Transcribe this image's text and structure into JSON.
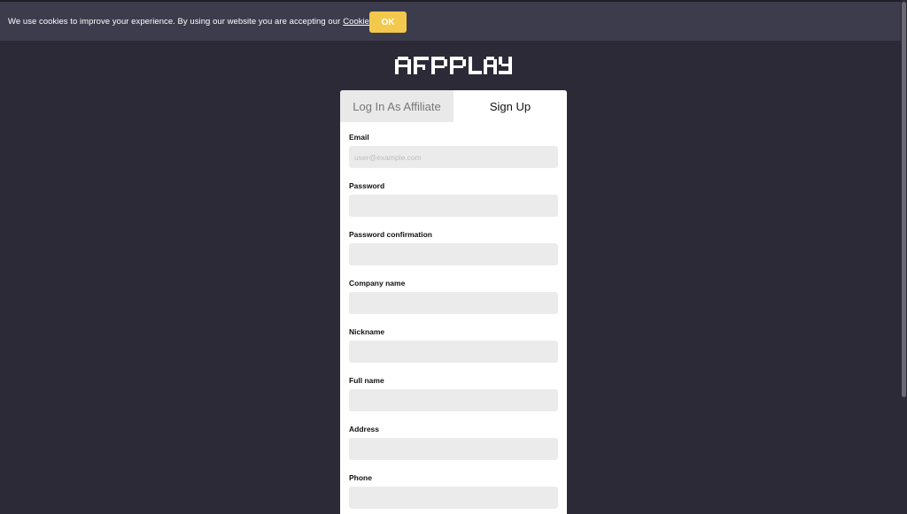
{
  "cookie_bar": {
    "text": "We use cookies to improve your experience. By using our website you are accepting our",
    "link_label": "Cookie Policy",
    "ok_label": "OK"
  },
  "logo": {
    "text": "AFFPLAY",
    "icon": "affplay-logo"
  },
  "tabs": [
    {
      "label": "Log In As Affiliate",
      "active": false
    },
    {
      "label": "Sign Up",
      "active": true
    }
  ],
  "form": {
    "fields": [
      {
        "label": "Email",
        "placeholder": "user@example.com",
        "value": ""
      },
      {
        "label": "Password",
        "placeholder": "",
        "value": ""
      },
      {
        "label": "Password confirmation",
        "placeholder": "",
        "value": ""
      },
      {
        "label": "Company name",
        "placeholder": "",
        "value": ""
      },
      {
        "label": "Nickname",
        "placeholder": "",
        "value": ""
      },
      {
        "label": "Full name",
        "placeholder": "",
        "value": ""
      },
      {
        "label": "Address",
        "placeholder": "",
        "value": ""
      },
      {
        "label": "Phone",
        "placeholder": "",
        "value": ""
      }
    ]
  },
  "colors": {
    "background": "#2c2a36",
    "cookie_bar": "#3d3c4d",
    "ok_button": "#f2c94c",
    "input_bg": "#ebebeb"
  }
}
